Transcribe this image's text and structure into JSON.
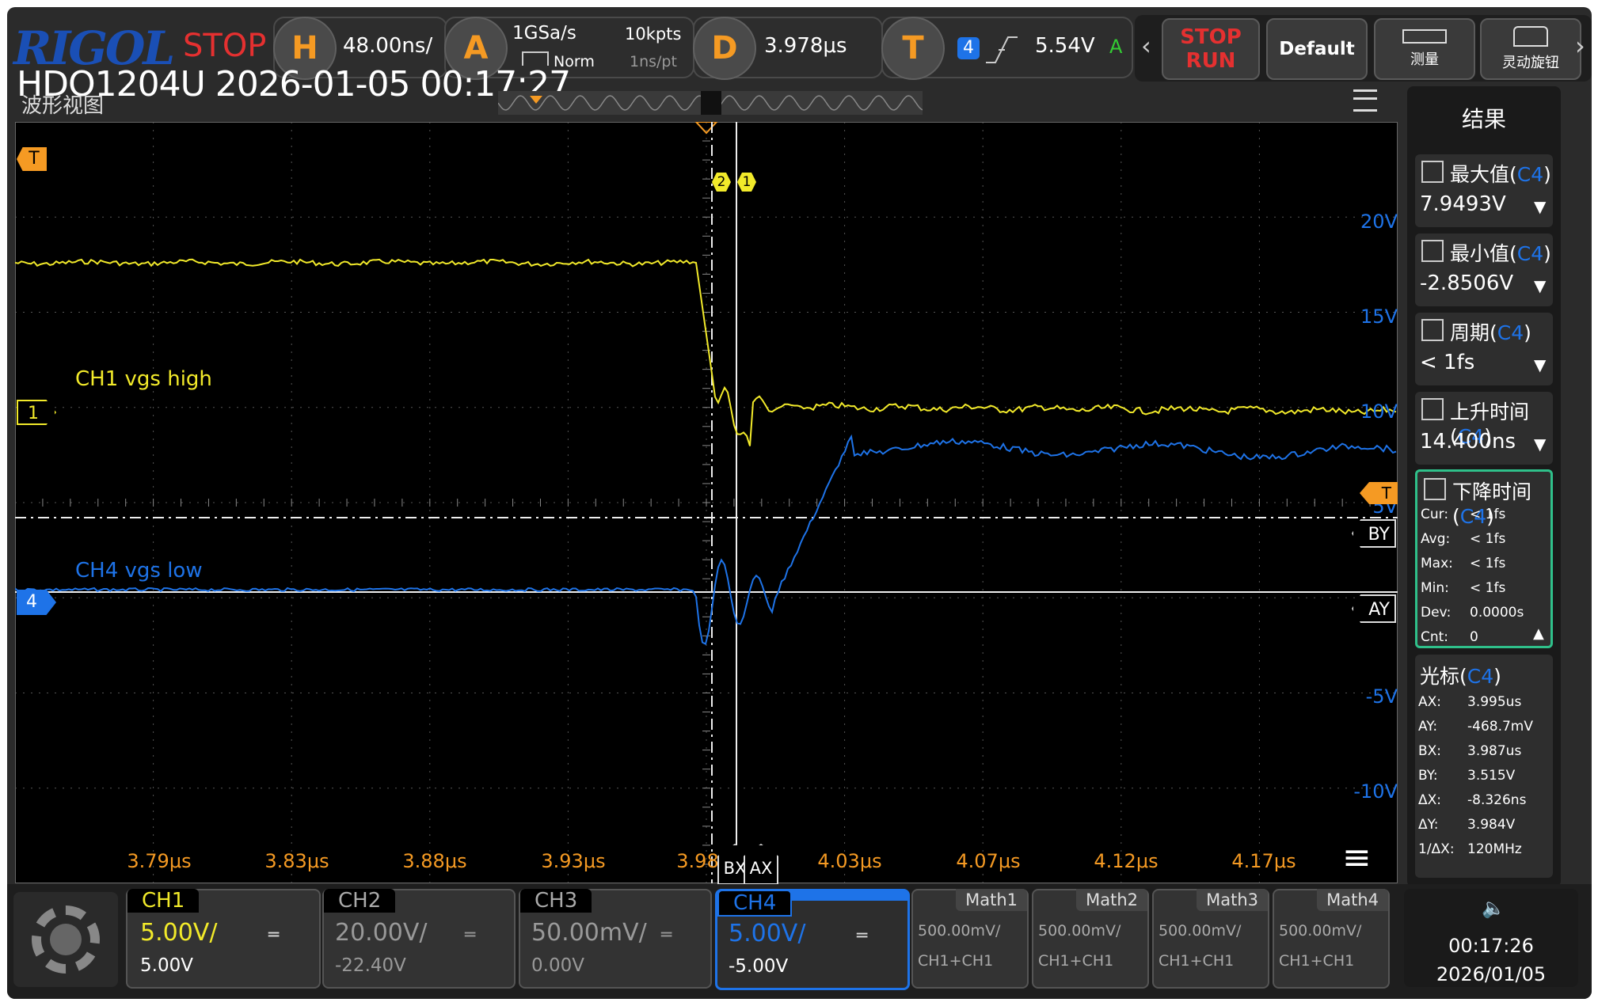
{
  "topbar": {
    "brand": "RIGOL",
    "run_state": "STOP",
    "horizontal": {
      "key": "H",
      "value": "48.00ns/"
    },
    "acquire": {
      "key": "A",
      "sample_rate": "1GSa/s",
      "mode": "Norm",
      "memory": "10kpts",
      "resolution": "1ns/pt"
    },
    "delay": {
      "key": "D",
      "value": "3.978μs"
    },
    "trigger": {
      "key": "T",
      "source": "4",
      "level": "5.54V",
      "sweep": "A"
    },
    "stop_run_top": "STOP",
    "stop_run_bottom": "RUN",
    "default_label": "Default",
    "measure_label": "测量",
    "knob_label": "灵动旋钮",
    "model_timestamp": "HDO1204U 2026-01-05 00:17:27",
    "waveform_view_label": "波形视图"
  },
  "plot": {
    "trigger_marker": "T",
    "ch1_marker": "1",
    "ch4_marker": "4",
    "ch1_label": "CH1 vgs high",
    "ch4_label": "CH4 vgs low",
    "cursor_tag_2": "2",
    "cursor_tag_1": "1",
    "y_labels": [
      "20V",
      "15V",
      "10V",
      "5V",
      "-5V",
      "-10V"
    ],
    "x_labels": [
      "3.79μs",
      "3.83μs",
      "3.88μs",
      "3.93μs",
      "3.98",
      "4.03μs",
      "4.07μs",
      "4.12μs",
      "4.17μs"
    ],
    "cursor_labels": {
      "by": "BY",
      "ay": "AY",
      "bx": "BX",
      "ax": "AX",
      "trig_right": "T"
    },
    "colors": {
      "ch1": "#f2ea2a",
      "ch4": "#1e73e8",
      "accent": "#f59a23"
    }
  },
  "results": {
    "title": "结果",
    "max": {
      "label": "最大值",
      "src": "C4",
      "value": "7.9493V"
    },
    "min": {
      "label": "最小值",
      "src": "C4",
      "value": "-2.8506V"
    },
    "period": {
      "label": "周期",
      "src": "C4",
      "value": "< 1fs"
    },
    "rise": {
      "label": "上升时间",
      "src": "C4",
      "value": "14.400ns"
    },
    "fall": {
      "label": "下降时间",
      "src": "C4",
      "stats": [
        {
          "k": "Cur:",
          "v": "< 1fs"
        },
        {
          "k": "Avg:",
          "v": "< 1fs"
        },
        {
          "k": "Max:",
          "v": "< 1fs"
        },
        {
          "k": "Min:",
          "v": "< 1fs"
        },
        {
          "k": "Dev:",
          "v": "0.0000s"
        },
        {
          "k": "Cnt:",
          "v": "0"
        }
      ]
    },
    "cursor": {
      "label": "光标",
      "src": "C4",
      "stats": [
        {
          "k": "AX:",
          "v": "3.995us"
        },
        {
          "k": "AY:",
          "v": "-468.7mV"
        },
        {
          "k": "BX:",
          "v": "3.987us"
        },
        {
          "k": "BY:",
          "v": "3.515V"
        },
        {
          "k": "ΔX:",
          "v": "-8.326ns"
        },
        {
          "k": "ΔY:",
          "v": "3.984V"
        },
        {
          "k": "1/ΔX:",
          "v": "120MHz"
        }
      ]
    }
  },
  "bottom": {
    "channels": [
      {
        "name": "CH1",
        "scale": "5.00V/",
        "offset": "5.00V"
      },
      {
        "name": "CH2",
        "scale": "20.00V/",
        "offset": "-22.40V"
      },
      {
        "name": "CH3",
        "scale": "50.00mV/",
        "offset": "0.00V"
      },
      {
        "name": "CH4",
        "scale": "5.00V/",
        "offset": "-5.00V"
      }
    ],
    "maths": [
      {
        "name": "Math1",
        "scale": "500.00mV/",
        "expr": "CH1+CH1"
      },
      {
        "name": "Math2",
        "scale": "500.00mV/",
        "expr": "CH1+CH1"
      },
      {
        "name": "Math3",
        "scale": "500.00mV/",
        "expr": "CH1+CH1"
      },
      {
        "name": "Math4",
        "scale": "500.00mV/",
        "expr": "CH1+CH1"
      }
    ],
    "time": "00:17:26",
    "date": "2026/01/05"
  }
}
